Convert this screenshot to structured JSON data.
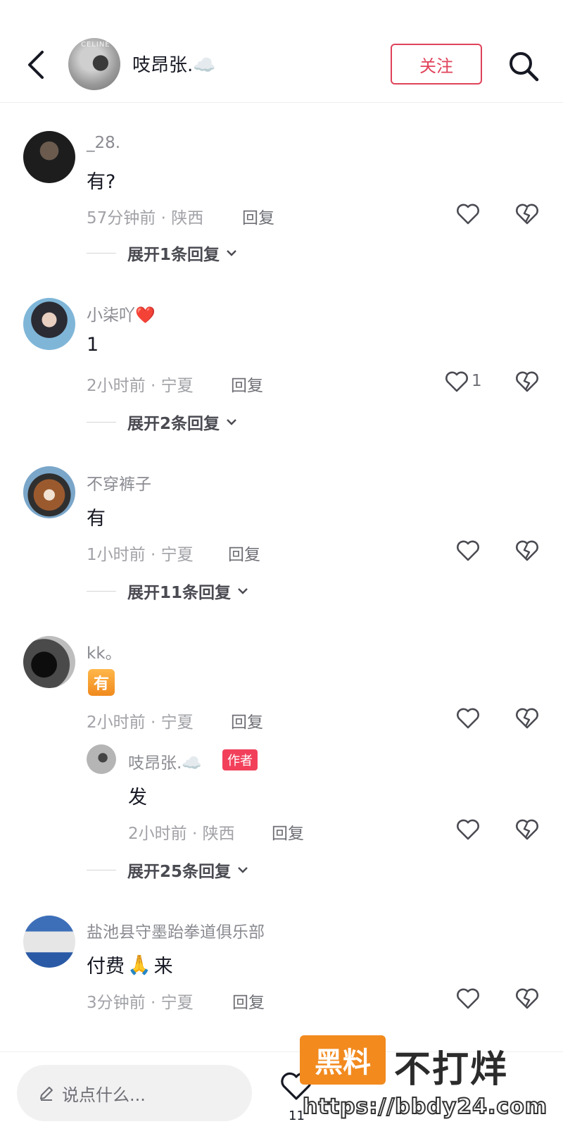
{
  "header": {
    "name": "吱昂张.☁️",
    "follow_label": "关注",
    "avatar_tag": "CELINE"
  },
  "comments": [
    {
      "username": "_28.",
      "text": "有?",
      "meta": "57分钟前 · 陕西",
      "reply_label": "回复",
      "expand": "展开1条回复"
    },
    {
      "username": "小柒吖❤️",
      "text": "1",
      "meta": "2小时前 · 宁夏",
      "reply_label": "回复",
      "likes": "1",
      "expand": "展开2条回复"
    },
    {
      "username": "不穿裤子",
      "text": "有",
      "meta": "1小时前 · 宁夏",
      "reply_label": "回复",
      "expand": "展开11条回复"
    },
    {
      "username": "kk。",
      "emoji_text": "有",
      "meta": "2小时前 · 宁夏",
      "reply_label": "回复",
      "sub_reply": {
        "username": "吱昂张.☁️",
        "badge": "作者",
        "text": "发",
        "meta": "2小时前 · 陕西",
        "reply_label": "回复"
      },
      "expand": "展开25条回复"
    },
    {
      "username": "盐池县守墨跆拳道俱乐部",
      "text_before": "付费",
      "text_emoji": "🙏",
      "text_after": "来",
      "meta": "3分钟前 · 宁夏",
      "reply_label": "回复"
    }
  ],
  "bottom": {
    "placeholder": "说点什么...",
    "like_count": "11"
  },
  "watermark": {
    "box": "黑料",
    "title": "不打烊",
    "url": "https://bbdy24.com"
  },
  "colors": {
    "accent": "#e0425a",
    "badge": "#f2405b",
    "meta_gray": "#a1a2a7"
  }
}
